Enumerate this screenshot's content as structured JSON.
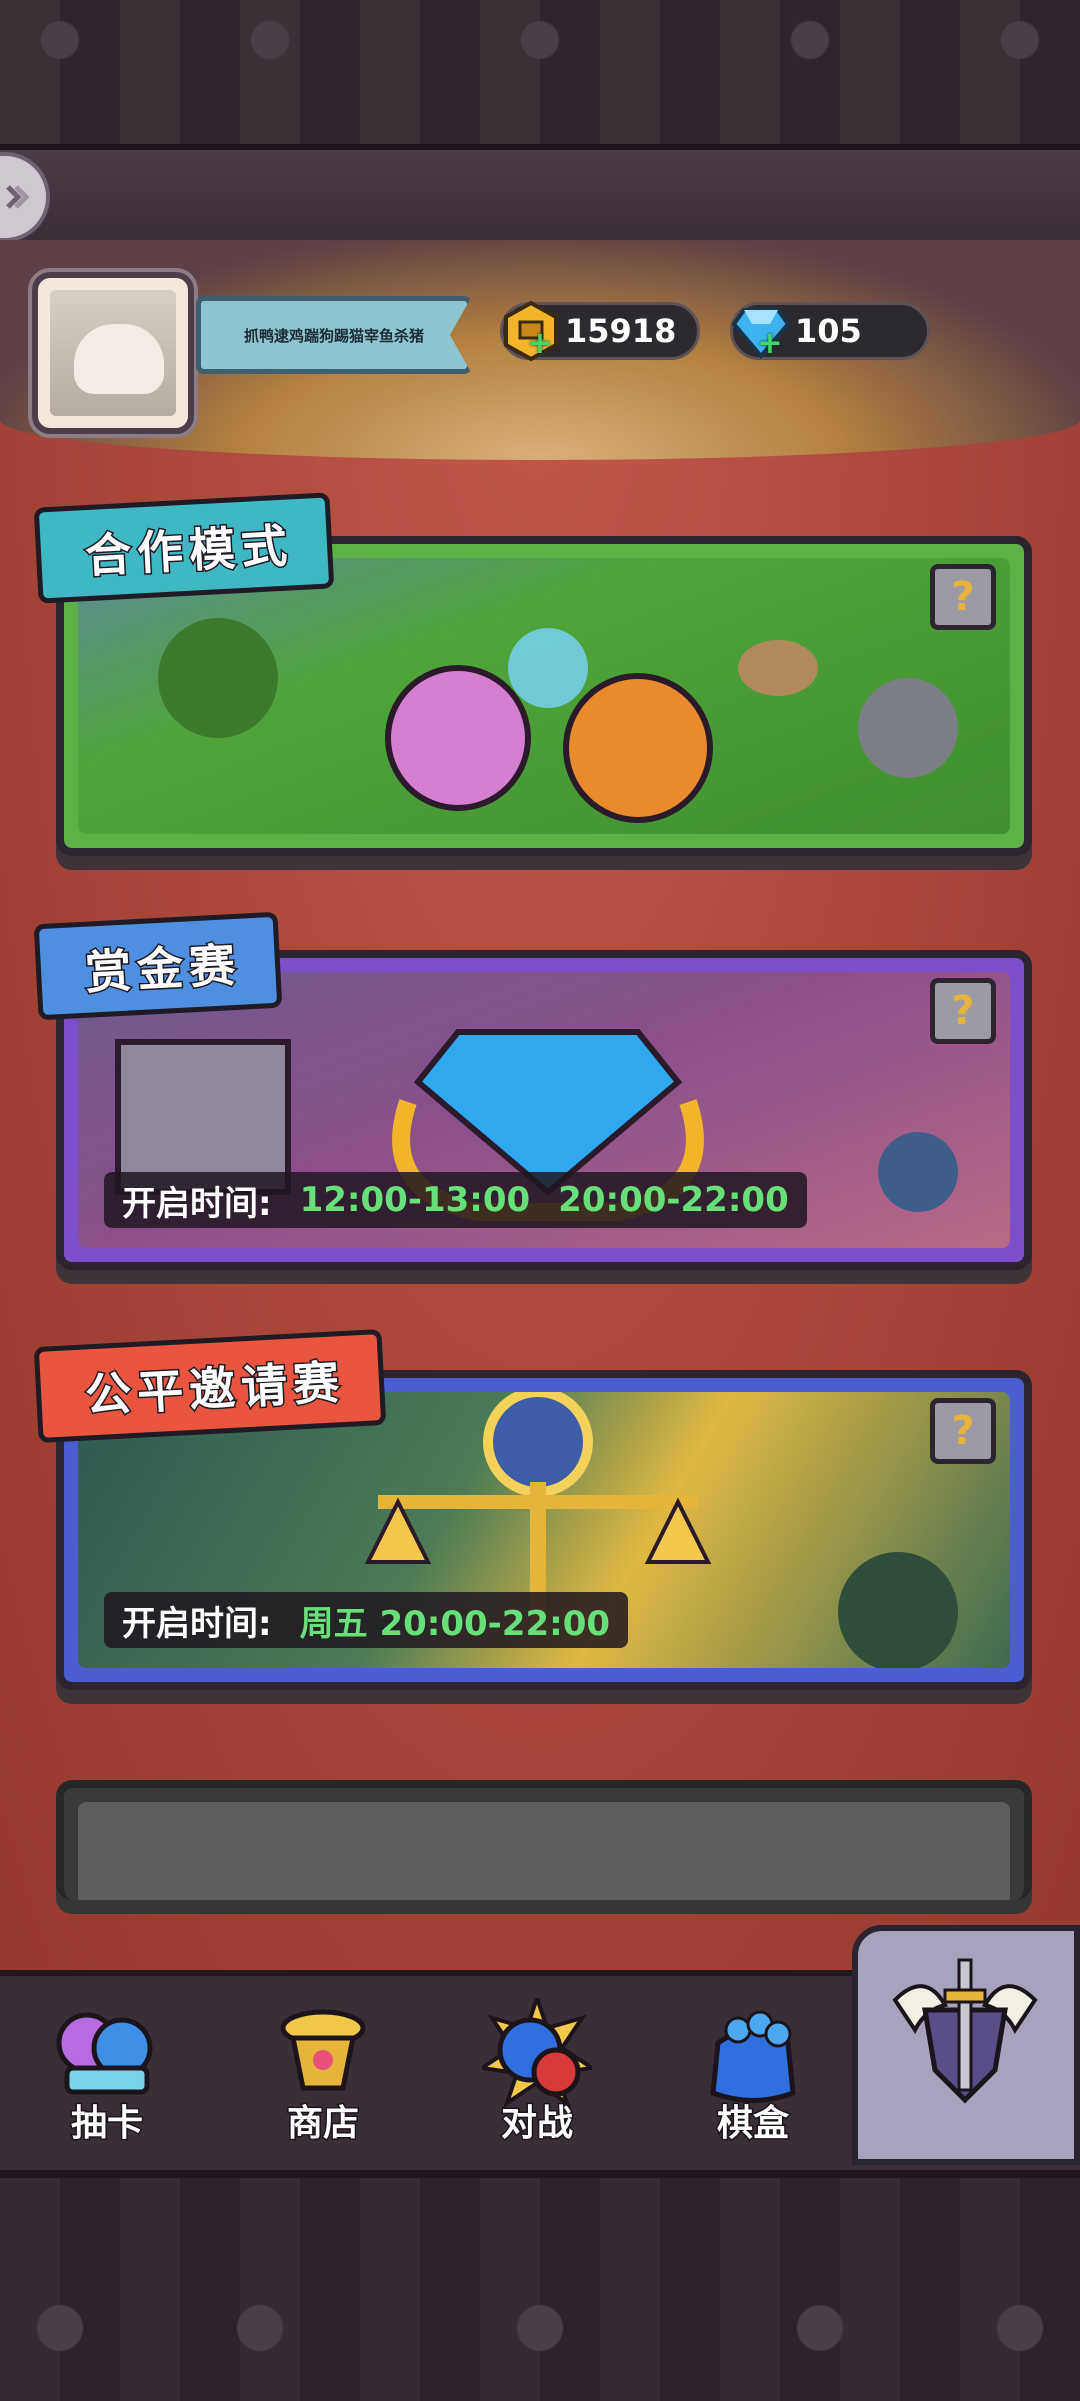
{
  "player": {
    "name": "抓鸭逮鸡踹狗踢猫宰鱼杀猪",
    "avatar_icon": "cat-avatar-icon"
  },
  "resources": {
    "coins": "15918",
    "gems": "105"
  },
  "modes": [
    {
      "title": "合作模式",
      "help": "?",
      "color": "#5bb143"
    },
    {
      "title": "赏金赛",
      "help": "?",
      "time_label": "开启时间:",
      "times": [
        "12:00-13:00",
        "20:00-22:00"
      ],
      "color": "#7b4fc9"
    },
    {
      "title": "公平邀请赛",
      "help": "?",
      "time_label": "开启时间:",
      "times": [
        "周五 20:00-22:00"
      ],
      "color": "#4a5ed0"
    }
  ],
  "nav": {
    "items": [
      {
        "label": "抽卡",
        "icon": "card-draw-icon"
      },
      {
        "label": "商店",
        "icon": "shop-icon"
      },
      {
        "label": "对战",
        "icon": "battle-icon"
      },
      {
        "label": "棋盒",
        "icon": "chess-box-icon"
      },
      {
        "label": "",
        "icon": "winged-sword-icon"
      }
    ]
  },
  "colors": {
    "stage": "#a8463a",
    "time_green": "#67e07a",
    "help_question": "#e6b43d"
  }
}
